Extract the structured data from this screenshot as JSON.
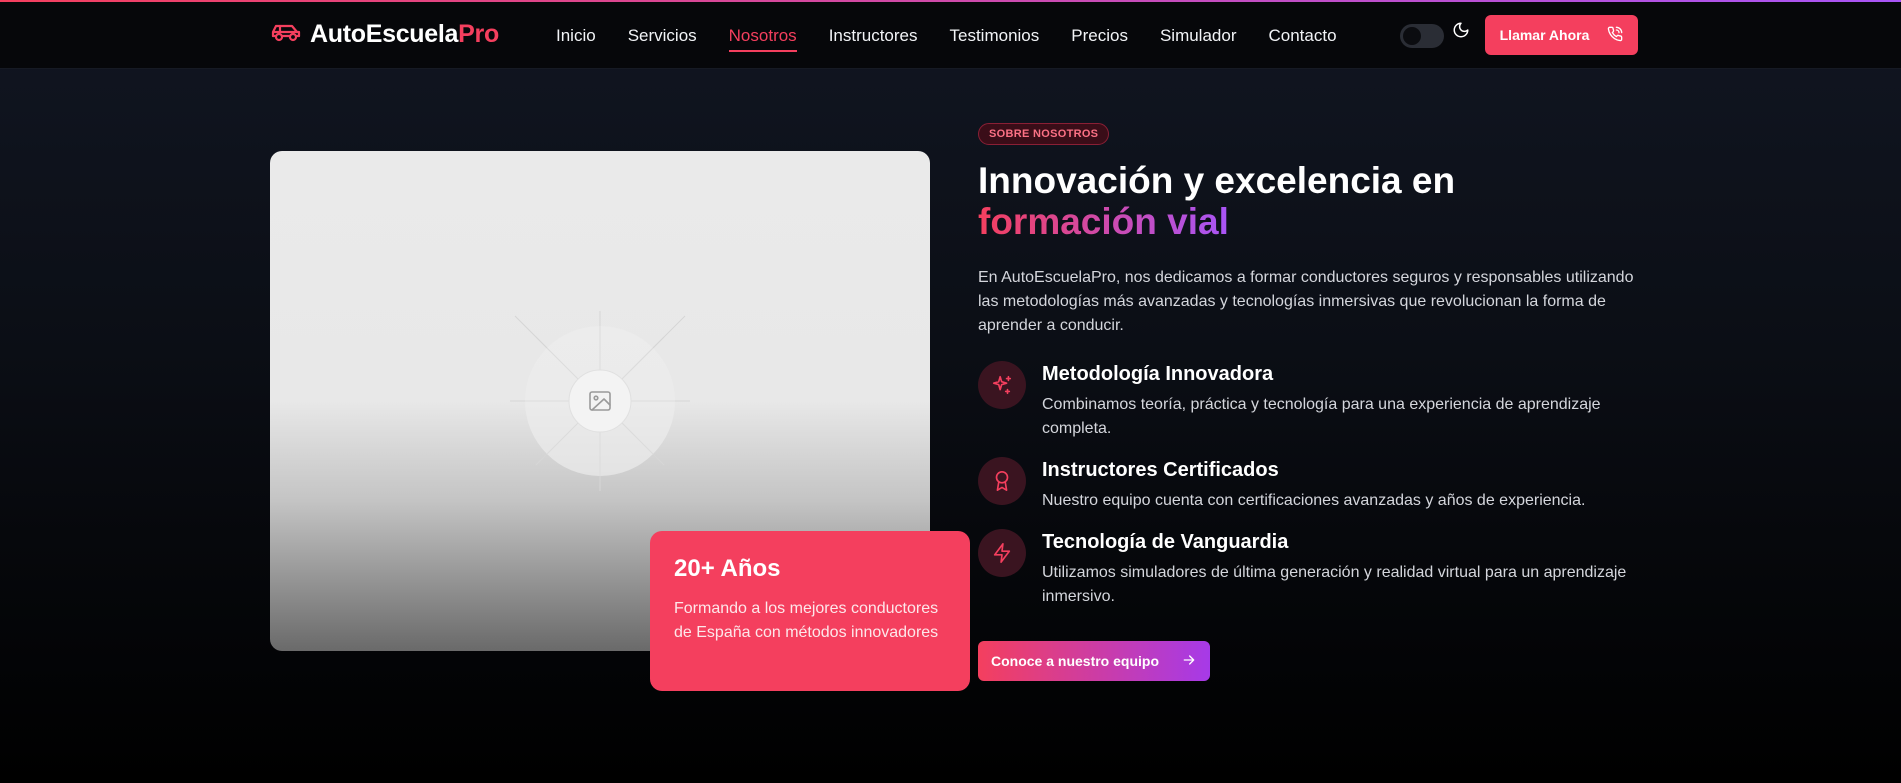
{
  "brand": {
    "name_main": "AutoEscuela",
    "name_accent": "Pro",
    "icon": "car-icon"
  },
  "nav": {
    "items": [
      {
        "label": "Inicio"
      },
      {
        "label": "Servicios"
      },
      {
        "label": "Nosotros",
        "active": true
      },
      {
        "label": "Instructores"
      },
      {
        "label": "Testimonios"
      },
      {
        "label": "Precios"
      },
      {
        "label": "Simulador"
      },
      {
        "label": "Contacto"
      }
    ]
  },
  "header": {
    "theme_toggle_icon": "moon-icon",
    "call_label": "Llamar Ahora",
    "call_icon": "phone-call-icon"
  },
  "about": {
    "badge": "SOBRE NOSOTROS",
    "title_line1": "Innovación y excelencia en",
    "title_line2": "formación vial",
    "description": "En AutoEscuelaPro, nos dedicamos a formar conductores seguros y responsables utilizando las metodologías más avanzadas y tecnologías inmersivas que revolucionan la forma de aprender a conducir.",
    "features": [
      {
        "icon": "sparkles-icon",
        "title": "Metodología Innovadora",
        "desc": "Combinamos teoría, práctica y tecnología para una experiencia de aprendizaje completa."
      },
      {
        "icon": "award-icon",
        "title": "Instructores Certificados",
        "desc": "Nuestro equipo cuenta con certificaciones avanzadas y años de experiencia."
      },
      {
        "icon": "zap-icon",
        "title": "Tecnología de Vanguardia",
        "desc": "Utilizamos simuladores de última generación y realidad virtual para un aprendizaje inmersivo."
      }
    ],
    "cta_label": "Conoce a nuestro equipo",
    "cta_icon": "arrow-right-icon",
    "image_icon": "image-placeholder-icon",
    "stat": {
      "title": "20+ Años",
      "desc": "Formando a los mejores conductores de España con métodos innovadores"
    }
  },
  "colors": {
    "accent": "#f43f5e",
    "accent_purple": "#a855f7",
    "background": "#0b0e15"
  }
}
